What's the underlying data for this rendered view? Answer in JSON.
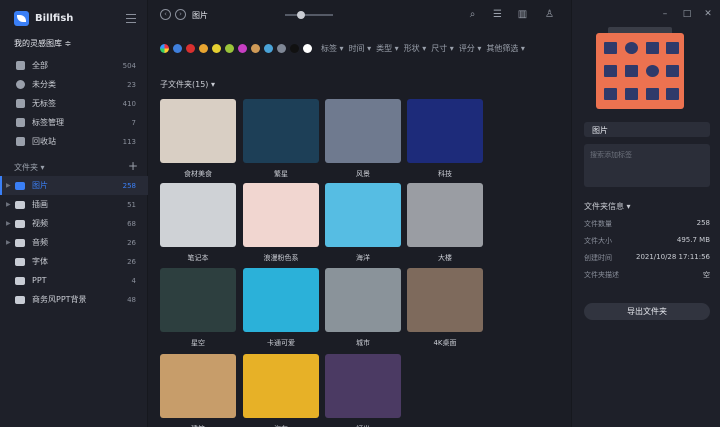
{
  "app": {
    "name": "Billfish",
    "library": "我的灵感图库 ≑"
  },
  "sidebar": {
    "items": [
      {
        "label": "全部",
        "count": "504",
        "icon": "grid-icon"
      },
      {
        "label": "未分类",
        "count": "23",
        "icon": "pie-icon"
      },
      {
        "label": "无标签",
        "count": "410",
        "icon": "tag-off-icon"
      },
      {
        "label": "标签管理",
        "count": "7",
        "icon": "tag-icon"
      },
      {
        "label": "回收站",
        "count": "113",
        "icon": "trash-icon"
      }
    ],
    "folders_header": "文件夹 ▾",
    "folders": [
      {
        "label": "图片",
        "count": "258",
        "active": true
      },
      {
        "label": "插画",
        "count": "51"
      },
      {
        "label": "视频",
        "count": "68"
      },
      {
        "label": "音频",
        "count": "26"
      },
      {
        "label": "字体",
        "count": "26"
      },
      {
        "label": "PPT",
        "count": "4"
      },
      {
        "label": "商务风PPT背景",
        "count": "48"
      }
    ]
  },
  "toolbar": {
    "breadcrumb": "图片"
  },
  "filters": {
    "colors": [
      "#3f7fdc",
      "#d9302f",
      "#e8a531",
      "#e5cf31",
      "#9ac43a",
      "#c73ec3",
      "#cf9a57",
      "#4aa3d8",
      "#7f8796",
      "#111111",
      "#ffffff"
    ],
    "labels": [
      "标签 ▾",
      "时间 ▾",
      "类型 ▾",
      "形状 ▾",
      "尺寸 ▾",
      "评分 ▾",
      "其他筛选 ▾"
    ]
  },
  "subfolders": {
    "title": "子文件夹(15) ▾",
    "items": [
      {
        "label": "食材美食",
        "bg": "#d9cfc4"
      },
      {
        "label": "繁星",
        "bg": "#1d3f57"
      },
      {
        "label": "风景",
        "bg": "#6f7a8f"
      },
      {
        "label": "科技",
        "bg": "#1d2b7a"
      },
      {
        "label": "笔记本",
        "bg": "#cfd2d6"
      },
      {
        "label": "浪漫粉色系",
        "bg": "#f1d6d0"
      },
      {
        "label": "海洋",
        "bg": "#56bde3"
      },
      {
        "label": "大楼",
        "bg": "#9a9da3"
      },
      {
        "label": "星空",
        "bg": "#2d3f3f"
      },
      {
        "label": "卡通可爱",
        "bg": "#2bb1d9"
      },
      {
        "label": "城市",
        "bg": "#8a939a"
      },
      {
        "label": "4K桌面",
        "bg": "#7e6a5c"
      },
      {
        "label": "建筑",
        "bg": "#c79d6a"
      },
      {
        "label": "汽车",
        "bg": "#e7b127"
      },
      {
        "label": "灯光",
        "bg": "#4b3a63"
      }
    ]
  },
  "inspector": {
    "name": "图片",
    "tag_placeholder": "搜索添加标签",
    "info_title": "文件夹信息 ▾",
    "rows": [
      {
        "key": "文件数量",
        "value": "258"
      },
      {
        "key": "文件大小",
        "value": "495.7 MB"
      },
      {
        "key": "创建时间",
        "value": "2021/10/28 17:11:56"
      },
      {
        "key": "文件夹描述",
        "value": "空"
      }
    ],
    "export_label": "导出文件夹"
  }
}
